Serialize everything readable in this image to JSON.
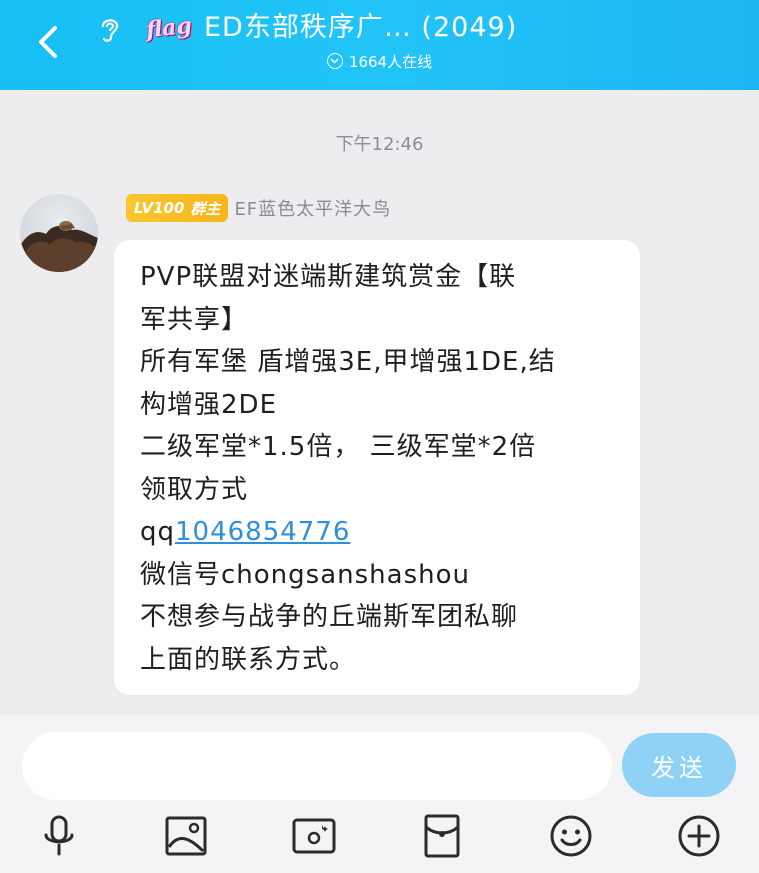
{
  "header": {
    "badge_text": "flag",
    "title": "ED东部秩序广… (2049)",
    "online_count": "1664人在线"
  },
  "chat": {
    "timestamp": "下午12:46",
    "message": {
      "sender_level": "LV100",
      "sender_role": "群主",
      "sender_name": "EF蓝色太平洋大鸟",
      "lines": [
        "PVP联盟对迷端斯建筑赏金【联",
        "军共享】",
        "所有军堡 盾增强3E,甲增强1DE,结",
        "构增强2DE",
        "二级军堂*1.5倍， 三级军堂*2倍",
        "领取方式"
      ],
      "qq_prefix": "qq",
      "qq_number": "1046854776",
      "lines_after": [
        "微信号chongsanshashou",
        "不想参与战争的丘端斯军团私聊",
        "上面的联系方式。"
      ]
    }
  },
  "input": {
    "placeholder": "",
    "value": "",
    "send_label": "发送"
  },
  "toolbar": {
    "items": [
      "microphone-icon",
      "image-icon",
      "camera-icon",
      "red-packet-icon",
      "emoji-icon",
      "plus-icon"
    ]
  }
}
